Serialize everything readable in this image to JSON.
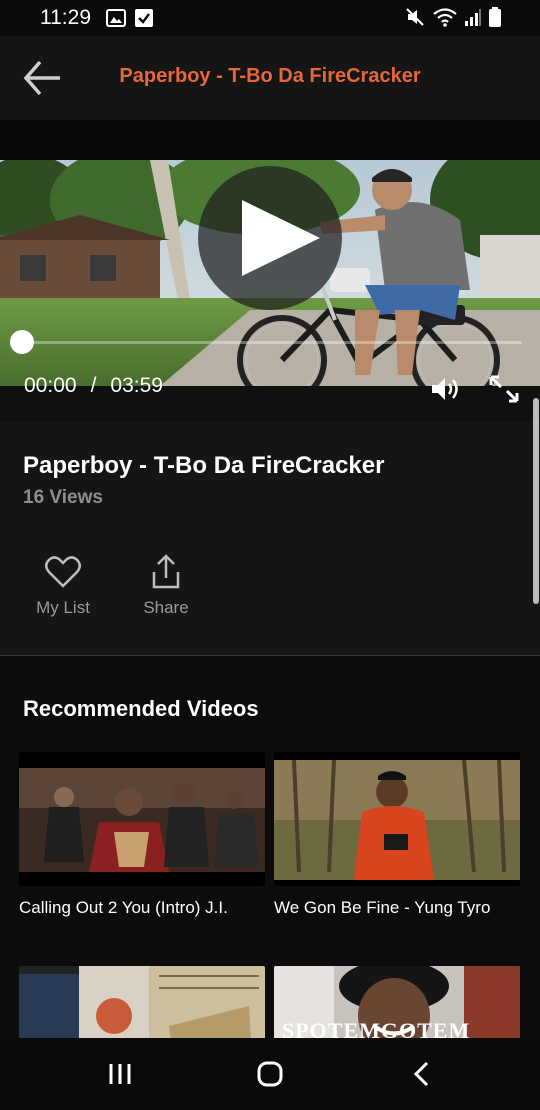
{
  "status_bar": {
    "time": "11:29",
    "left_icons": [
      "image-icon",
      "check-icon"
    ],
    "right_icons": [
      "mute-icon",
      "wifi-icon",
      "signal-icon",
      "battery-icon"
    ]
  },
  "header": {
    "title": "Paperboy - T-Bo Da FireCracker",
    "accent_color": "#e5673a",
    "back_icon": "back-arrow-icon"
  },
  "player": {
    "current_time": "00:00",
    "separator": "/",
    "duration": "03:59",
    "progress": 0,
    "icons": [
      "play-icon",
      "volume-icon",
      "fullscreen-icon"
    ]
  },
  "video": {
    "title": "Paperboy - T-Bo Da FireCracker",
    "views": "16 Views"
  },
  "actions": [
    {
      "label": "My List",
      "icon": "heart-icon"
    },
    {
      "label": "Share",
      "icon": "share-icon"
    }
  ],
  "recommended": {
    "heading": "Recommended Videos",
    "items": [
      {
        "title": "Calling Out 2 You (Intro) J.I."
      },
      {
        "title": "We Gon Be Fine - Yung Tyro"
      },
      {
        "title": ""
      },
      {
        "title": "",
        "thumb_text": "SPOTEMGOTEM"
      }
    ]
  },
  "nav_bar": {
    "icons": [
      "recent-apps-icon",
      "home-icon",
      "back-icon"
    ]
  }
}
